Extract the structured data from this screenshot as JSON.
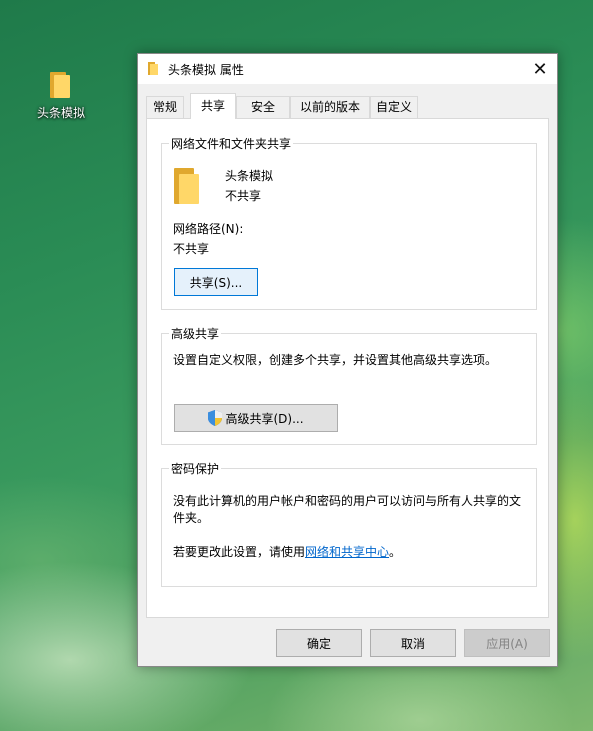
{
  "desktop": {
    "icon_label": "头条模拟"
  },
  "dialog": {
    "title": "头条模拟 属性",
    "close_glyph": "✕",
    "tabs": [
      "常规",
      "共享",
      "安全",
      "以前的版本",
      "自定义"
    ],
    "active_tab": "共享",
    "network_sharing": {
      "group_title": "网络文件和文件夹共享",
      "folder_name": "头条模拟",
      "share_status": "不共享",
      "path_label": "网络路径(N):",
      "path_value": "不共享",
      "share_button": "共享(S)..."
    },
    "advanced_sharing": {
      "group_title": "高级共享",
      "description": "设置自定义权限，创建多个共享，并设置其他高级共享选项。",
      "button": "高级共享(D)..."
    },
    "password_protection": {
      "group_title": "密码保护",
      "description_line1": "没有此计算机的用户帐户和密码的用户可以访问与所有人共享的文",
      "description_line2": "件夹。",
      "change_prefix": "若要更改此设置，请使用",
      "change_link": "网络和共享中心",
      "change_suffix": "。"
    },
    "buttons": {
      "ok": "确定",
      "cancel": "取消",
      "apply": "应用(A)"
    }
  },
  "colors": {
    "accent": "#0078d7",
    "link": "#0066cc",
    "folder": "#ffd768"
  }
}
